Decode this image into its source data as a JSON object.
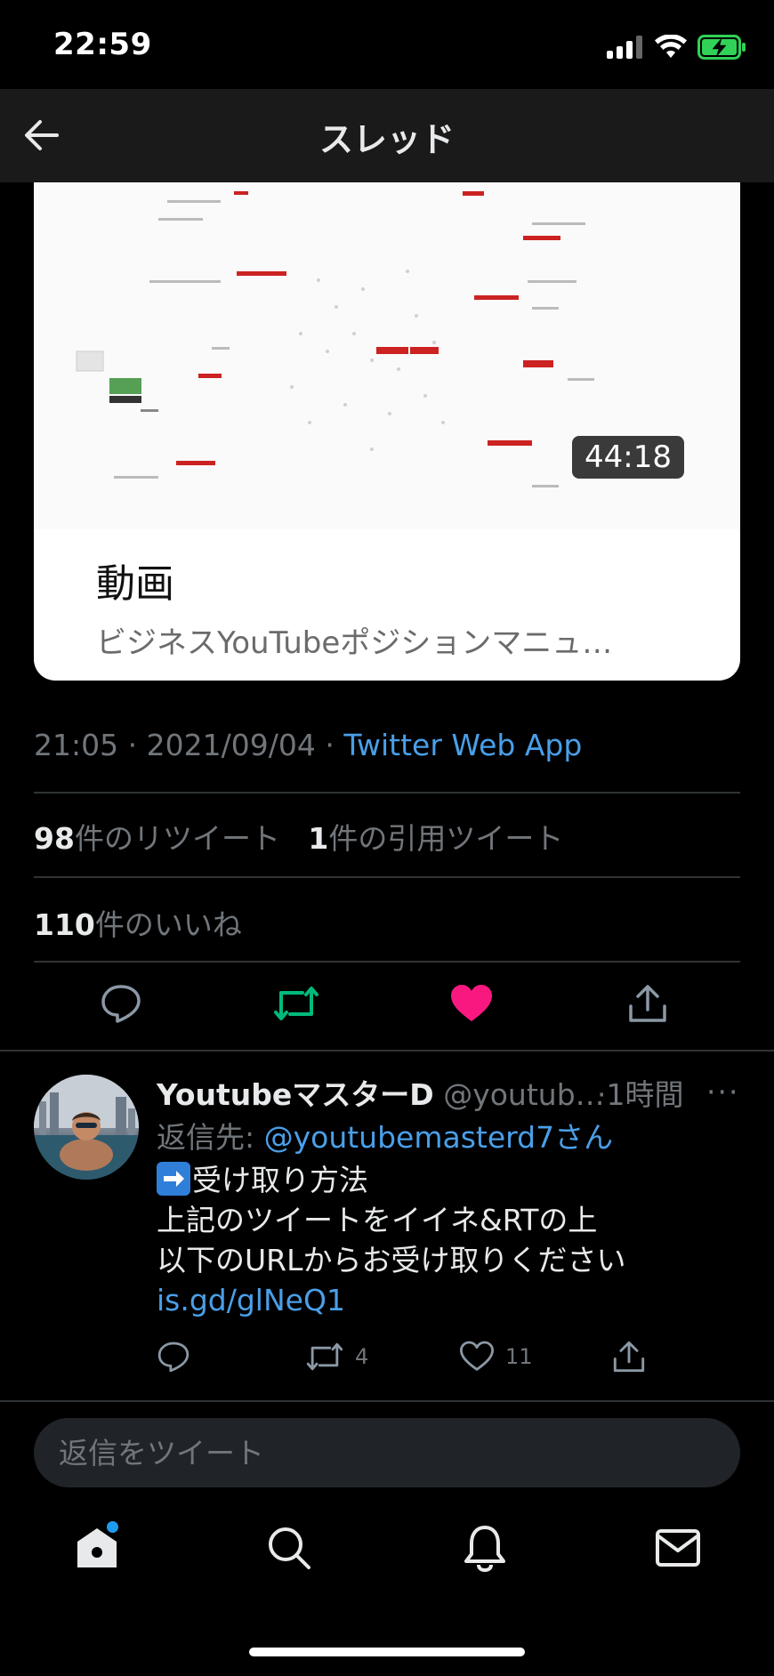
{
  "status_bar": {
    "time": "22:59"
  },
  "header": {
    "title": "スレッド"
  },
  "card": {
    "duration": "44:18",
    "title": "動画",
    "description": "ビジネスYouTubeポジションマニュ…"
  },
  "tweet_meta": {
    "time": "21:05",
    "date": "2021/09/04",
    "separator": "·",
    "source": "Twitter Web App"
  },
  "stats": {
    "retweets_count": "98",
    "retweets_label": "件のリツイート",
    "quotes_count": "1",
    "quotes_label": "件の引用ツイート",
    "likes_count": "110",
    "likes_label": "件のいいね"
  },
  "colors": {
    "retweet_active": "#00ba7c",
    "like_active": "#f91880",
    "link": "#4a9fe8"
  },
  "reply": {
    "name": "YoutubeマスターD",
    "handle": "@youtub…",
    "time": "·1時間",
    "more": "···",
    "reply_to_label": "返信先: ",
    "reply_to_handle": "@youtubemasterd7さん",
    "line1": "受け取り方法",
    "line2": "上記のツイートをイイネ&RTの上",
    "line3": "以下のURLからお受け取りください",
    "link": "is.gd/glNeQ1",
    "retweet_count": "4",
    "like_count": "11",
    "emoji_icon": "right-arrow-emoji-icon"
  },
  "compose": {
    "placeholder": "返信をツイート"
  },
  "tabbar": {
    "items": [
      "home-icon",
      "search-icon",
      "bell-icon",
      "mail-icon"
    ]
  }
}
